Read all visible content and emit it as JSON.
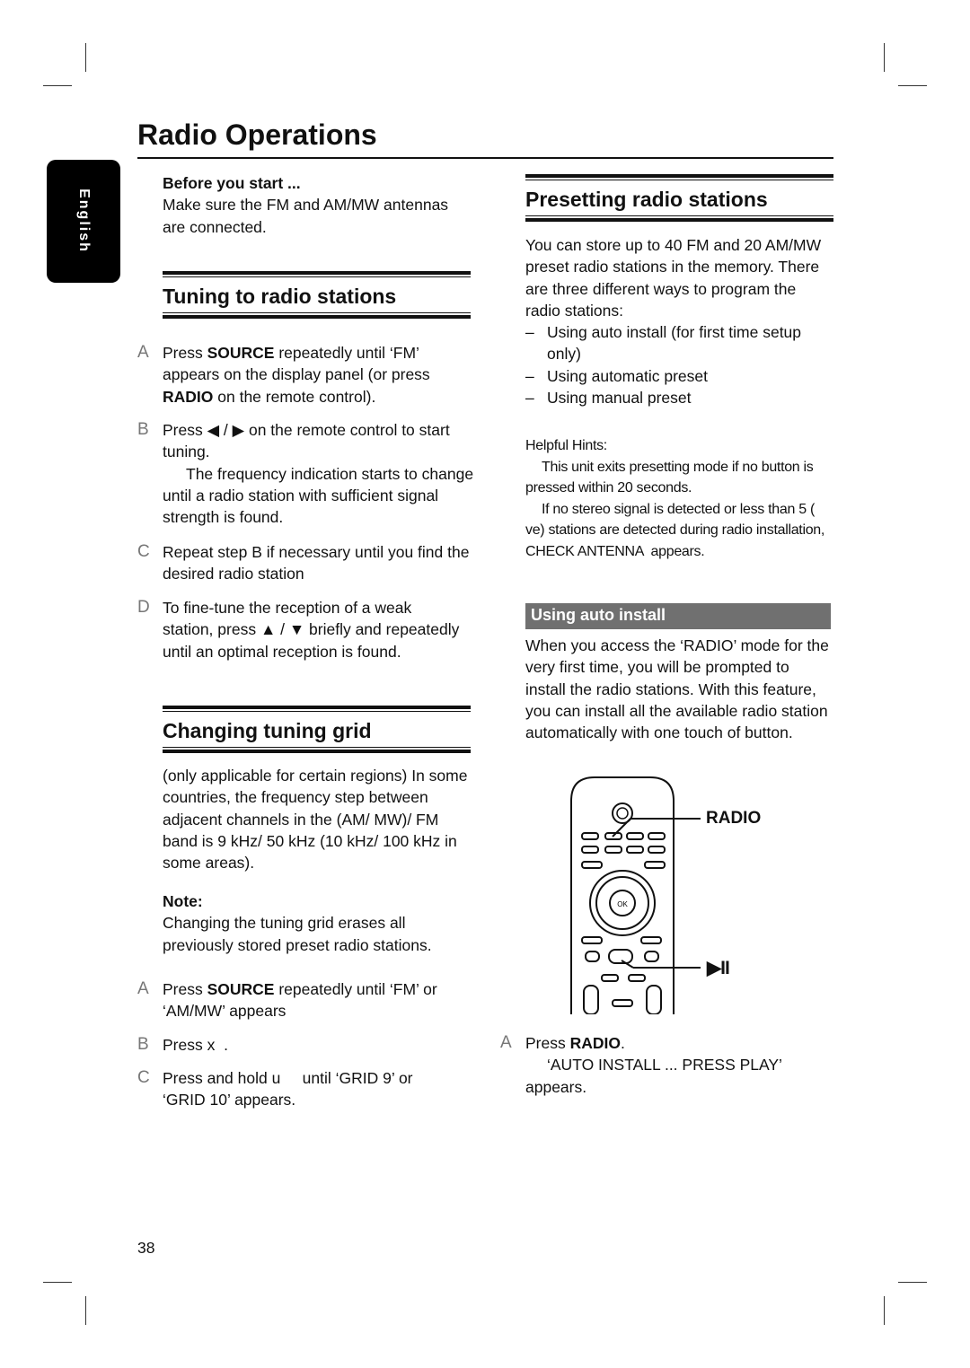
{
  "page": {
    "title": "Radio Operations",
    "language_tab": "English",
    "page_number": "38"
  },
  "left": {
    "before": {
      "heading": "Before you start ...",
      "text": "Make sure the FM and AM/MW antennas are connected."
    },
    "tuning": {
      "heading": "Tuning to radio stations",
      "steps": [
        {
          "letter": "A",
          "pre": "Press ",
          "bold": "SOURCE",
          "mid": " repeatedly until ‘FM’ appears on the display panel (or press ",
          "bold2": "RADIO",
          "post": " on the remote control)."
        },
        {
          "letter": "B",
          "text": "Press ◀ / ▶ on the remote control to start tuning.",
          "sub": "The frequency indication starts to change until a radio station with sufficient signal strength is found."
        },
        {
          "letter": "C",
          "text": "Repeat step B  if necessary until you find the desired radio station"
        },
        {
          "letter": "D",
          "text": "To fine-tune the reception of a weak station, press ▲ / ▼ briefly and repeatedly until an optimal reception is found."
        }
      ]
    },
    "grid": {
      "heading": "Changing tuning grid",
      "intro": "(only applicable for certain regions) In some countries, the frequency step between adjacent channels in the (AM/ MW)/ FM band is 9 kHz/ 50 kHz (10 kHz/ 100 kHz in some areas).",
      "note_label": "Note:",
      "note": "Changing the tuning grid erases all previously stored preset radio stations.",
      "steps": [
        {
          "letter": "A",
          "pre": "Press ",
          "bold": "SOURCE",
          "post": " repeatedly until ‘FM’ or ‘AM/MW’ appears"
        },
        {
          "letter": "B",
          "text": "Press x  ."
        },
        {
          "letter": "C",
          "text": "Press and hold u     until ‘GRID 9’ or ‘GRID 10’ appears."
        }
      ]
    }
  },
  "right": {
    "preset": {
      "heading": "Presetting radio stations",
      "intro": "You can store up to 40 FM and 20 AM/MW preset radio stations in the memory. There are three different ways to program the radio stations:",
      "ways": [
        "Using auto install (for first time setup only)",
        "Using automatic preset",
        "Using manual preset"
      ]
    },
    "hints": {
      "label": "Helpful Hints:",
      "items": [
        "This unit exits presetting mode if no button is pressed within 20 seconds.",
        "If no stereo signal is detected or less than 5 (  ve) stations are detected during radio installation,  CHECK ANTENNA  appears."
      ]
    },
    "auto": {
      "heading": "Using auto install",
      "text": "When you access the ‘RADIO’ mode for the very first time, you will be prompted to install the radio stations.  With this feature, you can install all the available radio station automatically with one touch of button.",
      "remote_labels": {
        "radio": "RADIO",
        "play": "▶II"
      },
      "step": {
        "letter": "A",
        "pre": "Press ",
        "bold": "RADIO",
        "post": ".",
        "sub": "‘AUTO INSTALL ... PRESS PLAY’ appears."
      }
    }
  }
}
